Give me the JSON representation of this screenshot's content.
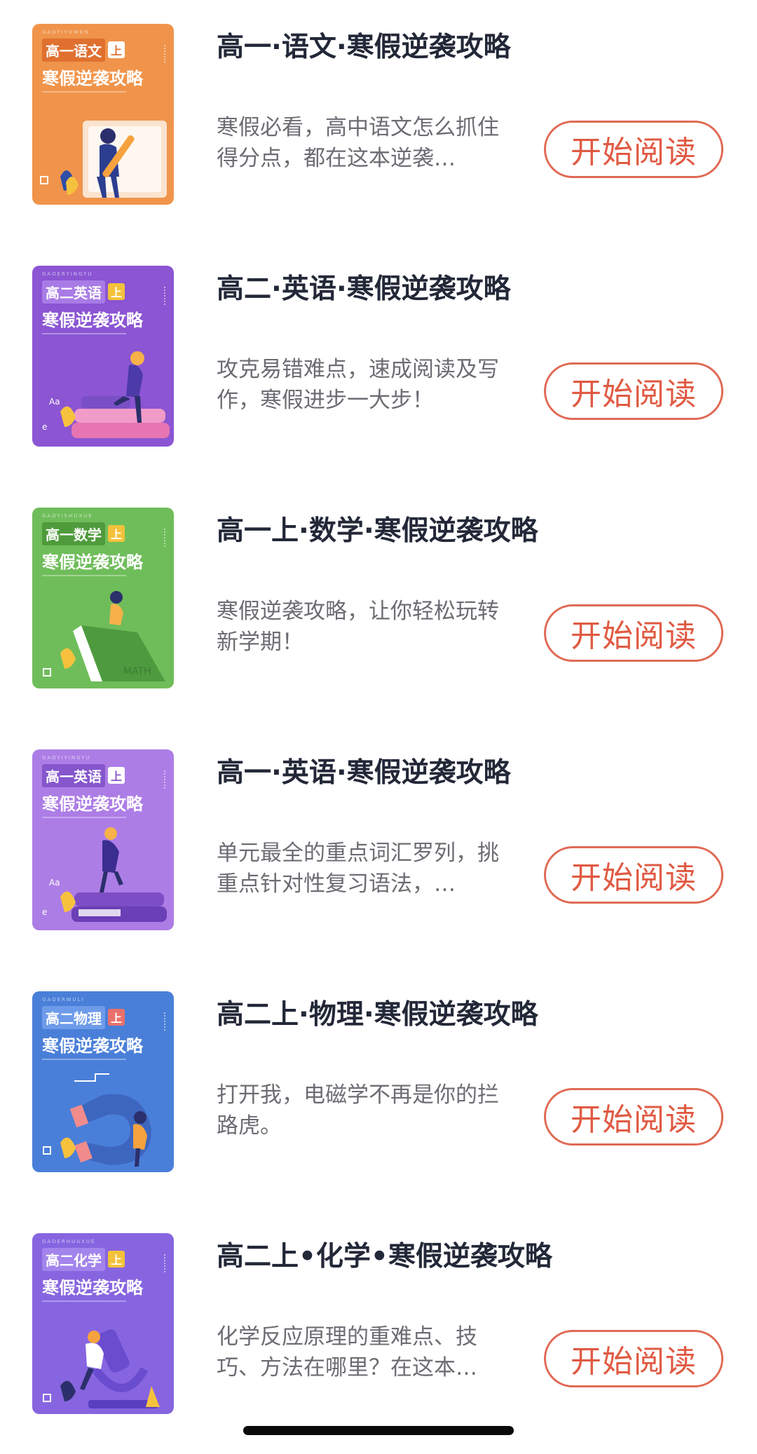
{
  "items": [
    {
      "cover_pinyin": "GAOYIYUWEN",
      "cover_subject": "高一语文",
      "cover_grade": "上",
      "cover_title": "寒假逆袭攻略",
      "title": "高一·语文·寒假逆袭攻略",
      "description": "寒假必看，高中语文怎么抓住得分点，都在这本逆袭…",
      "button_label": "开始阅读",
      "cover_color": "#f0944b",
      "subject_bg": "#e0702f",
      "grade_bg": "#ffffff",
      "grade_color": "#e0702f"
    },
    {
      "cover_pinyin": "GAOERYINGYU",
      "cover_subject": "高二英语",
      "cover_grade": "上",
      "cover_title": "寒假逆袭攻略",
      "title": "高二·英语·寒假逆袭攻略",
      "description": "攻克易错难点，速成阅读及写作，寒假进步一大步！",
      "button_label": "开始阅读",
      "cover_color": "#8b55d3",
      "subject_bg": "#a97be6",
      "grade_bg": "#f3c23a",
      "grade_color": "#ffffff"
    },
    {
      "cover_pinyin": "GAOYISHUXUE",
      "cover_subject": "高一数学",
      "cover_grade": "上",
      "cover_title": "寒假逆袭攻略",
      "title": "高一上·数学·寒假逆袭攻略",
      "description": "寒假逆袭攻略，让你轻松玩转新学期！",
      "button_label": "开始阅读",
      "cover_color": "#6fbd5a",
      "subject_bg": "#4f9b3c",
      "grade_bg": "#f3c23a",
      "grade_color": "#ffffff"
    },
    {
      "cover_pinyin": "GAOYIYINGYU",
      "cover_subject": "高一英语",
      "cover_grade": "上",
      "cover_title": "寒假逆袭攻略",
      "title": "高一·英语·寒假逆袭攻略",
      "description": "单元最全的重点词汇罗列，挑重点针对性复习语法，…",
      "button_label": "开始阅读",
      "cover_color": "#ad7de6",
      "subject_bg": "#8556cc",
      "grade_bg": "#ffffff",
      "grade_color": "#8556cc"
    },
    {
      "cover_pinyin": "GAOERWULI",
      "cover_subject": "高二物理",
      "cover_grade": "上",
      "cover_title": "寒假逆袭攻略",
      "title": "高二上·物理·寒假逆袭攻略",
      "description": "打开我，电磁学不再是你的拦路虎。",
      "button_label": "开始阅读",
      "cover_color": "#4a7fd9",
      "subject_bg": "#6d9bea",
      "grade_bg": "#e9706b",
      "grade_color": "#ffffff"
    },
    {
      "cover_pinyin": "GAOERHUAXUE",
      "cover_subject": "高二化学",
      "cover_grade": "上",
      "cover_title": "寒假逆袭攻略",
      "title": "高二上•化学•寒假逆袭攻略",
      "description": "化学反应原理的重难点、技巧、方法在哪里？在这本…",
      "button_label": "开始阅读",
      "cover_color": "#8765e0",
      "subject_bg": "#a384ec",
      "grade_bg": "#f3c23a",
      "grade_color": "#ffffff"
    }
  ]
}
